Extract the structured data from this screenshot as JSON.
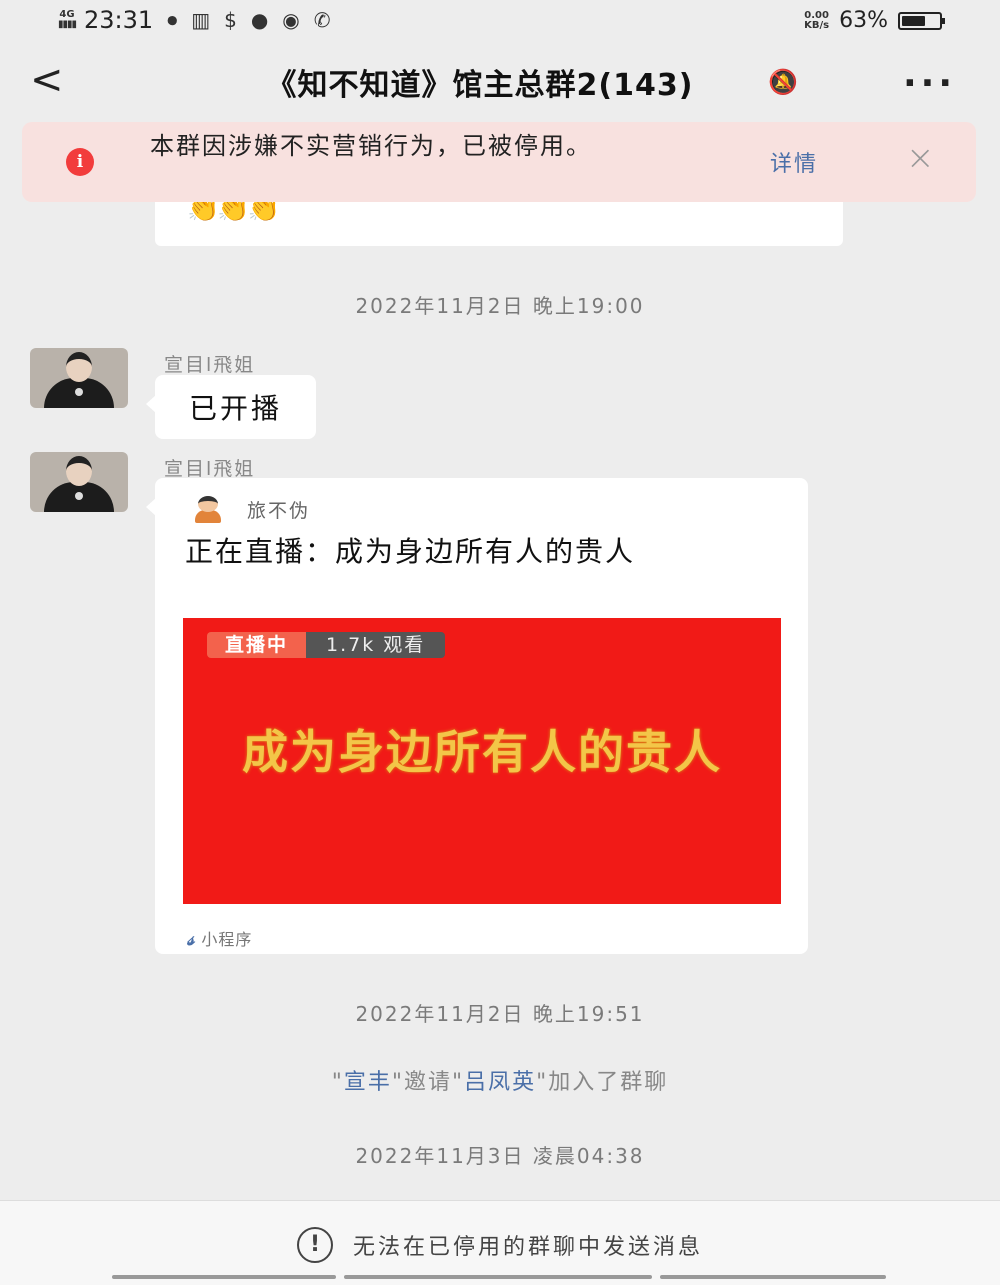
{
  "status_bar": {
    "network": "4G",
    "time": "23:31",
    "icons": [
      "screen-record-icon",
      "books-icon",
      "dollar-icon",
      "chat-icon",
      "wechat-icon",
      "phone-icon"
    ],
    "speed_value": "0.00",
    "speed_unit": "KB/s",
    "battery_percent": "63%",
    "battery_level": 0.63
  },
  "header": {
    "back_glyph": "<",
    "title": "《知不知道》馆主总群2(143)",
    "mute_icon": "bell-off-icon",
    "more_glyph": "..."
  },
  "banner": {
    "icon_glyph": "i",
    "text": "本群因涉嫌不实营销行为，已被停用。",
    "link": "详情",
    "close_glyph": "×",
    "colors": {
      "background": "#f8e1df",
      "icon": "#f23c3c",
      "link": "#4a6fa8"
    }
  },
  "previous_bubble_emoji": "👏👏👏",
  "messages": [
    {
      "timestamp": "2022年11月2日 晚上19:00",
      "sender": "宣目l飛姐",
      "text": "已开播"
    },
    {
      "sender": "宣目l飛姐",
      "card": {
        "source_name": "旅不伪",
        "title": "正在直播：成为身边所有人的贵人",
        "live_label": "直播中",
        "views": "1.7k 观看",
        "cover_text": "成为身边所有人的贵人",
        "footer": "小程序",
        "footer_icon": "miniprogram-icon",
        "cover_color": "#f11a17"
      }
    }
  ],
  "timestamp_2": "2022年11月2日 晚上19:51",
  "system_message": {
    "q1_open": "\"",
    "inviter": "宣丰",
    "q1_close": "\"",
    "verb": "邀请",
    "q2_open": "\"",
    "invitee": "吕凤英",
    "q2_close": "\"",
    "tail": "加入了群聊"
  },
  "timestamp_3": "2022年11月3日 凌晨04:38",
  "bottom_bar": {
    "icon_glyph": "!",
    "text": "无法在已停用的群聊中发送消息"
  }
}
